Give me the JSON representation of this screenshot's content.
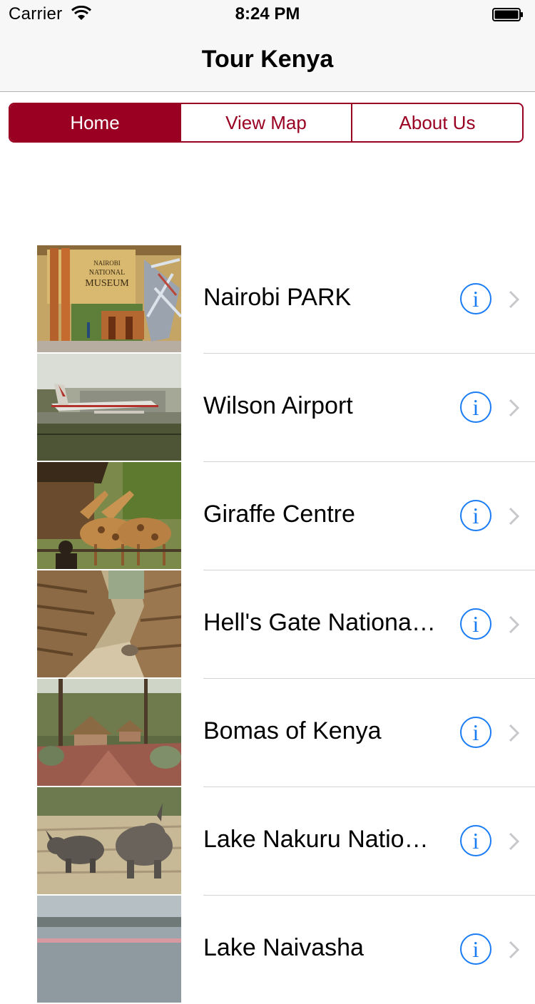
{
  "status_bar": {
    "carrier": "Carrier",
    "time": "8:24 PM"
  },
  "nav_bar": {
    "title": "Tour Kenya"
  },
  "segments": [
    {
      "label": "Home",
      "selected": true
    },
    {
      "label": "View Map",
      "selected": false
    },
    {
      "label": "About Us",
      "selected": false
    }
  ],
  "accent_color": "#9a0022",
  "info_color": "#1a7cf5",
  "info_glyph": "i",
  "museum_sign": [
    "NAIROBI",
    "NATIONAL",
    "MUSEUM"
  ],
  "places": [
    {
      "name": "Nairobi PARK",
      "image": "museum-photo"
    },
    {
      "name": "Wilson Airport",
      "image": "airport-photo"
    },
    {
      "name": "Giraffe Centre",
      "image": "giraffe-photo"
    },
    {
      "name": "Hell's Gate National Park",
      "image": "gorge-photo"
    },
    {
      "name": "Bomas of Kenya",
      "image": "huts-photo"
    },
    {
      "name": "Lake Nakuru National Park",
      "image": "rhino-photo"
    },
    {
      "name": "Lake Naivasha",
      "image": "lake-photo"
    }
  ]
}
